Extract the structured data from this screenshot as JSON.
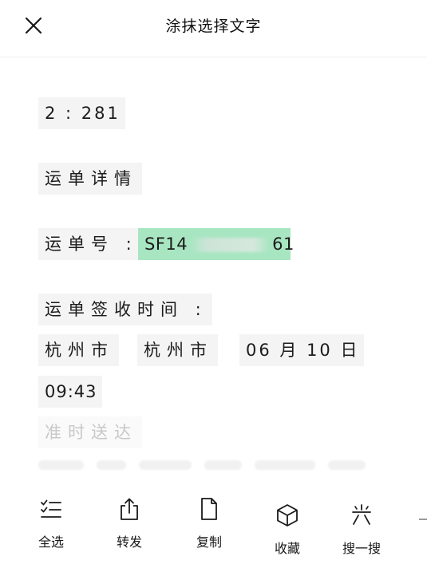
{
  "header": {
    "title": "涂抹选择文字",
    "close_icon": "close-icon"
  },
  "content": {
    "line1": "2 : 281",
    "line2": "运单详情",
    "line3_label": "运单号 :",
    "line3_value_prefix": "SF14",
    "line3_value_suffix": "61",
    "line4": "运单签收时间 :",
    "line5_a": "杭州市",
    "line5_b": "杭州市",
    "line5_c": "06 月 10 日",
    "line6": "09:43",
    "line7": "准时送达",
    "highlight_color": "#a8e6c2"
  },
  "toolbar": {
    "items": [
      {
        "label": "全选",
        "icon": "select-all-icon"
      },
      {
        "label": "转发",
        "icon": "share-icon"
      },
      {
        "label": "复制",
        "icon": "copy-icon"
      },
      {
        "label": "收藏",
        "icon": "favorite-cube-icon"
      },
      {
        "label": "搜一搜",
        "icon": "search-sparkle-icon"
      }
    ]
  }
}
